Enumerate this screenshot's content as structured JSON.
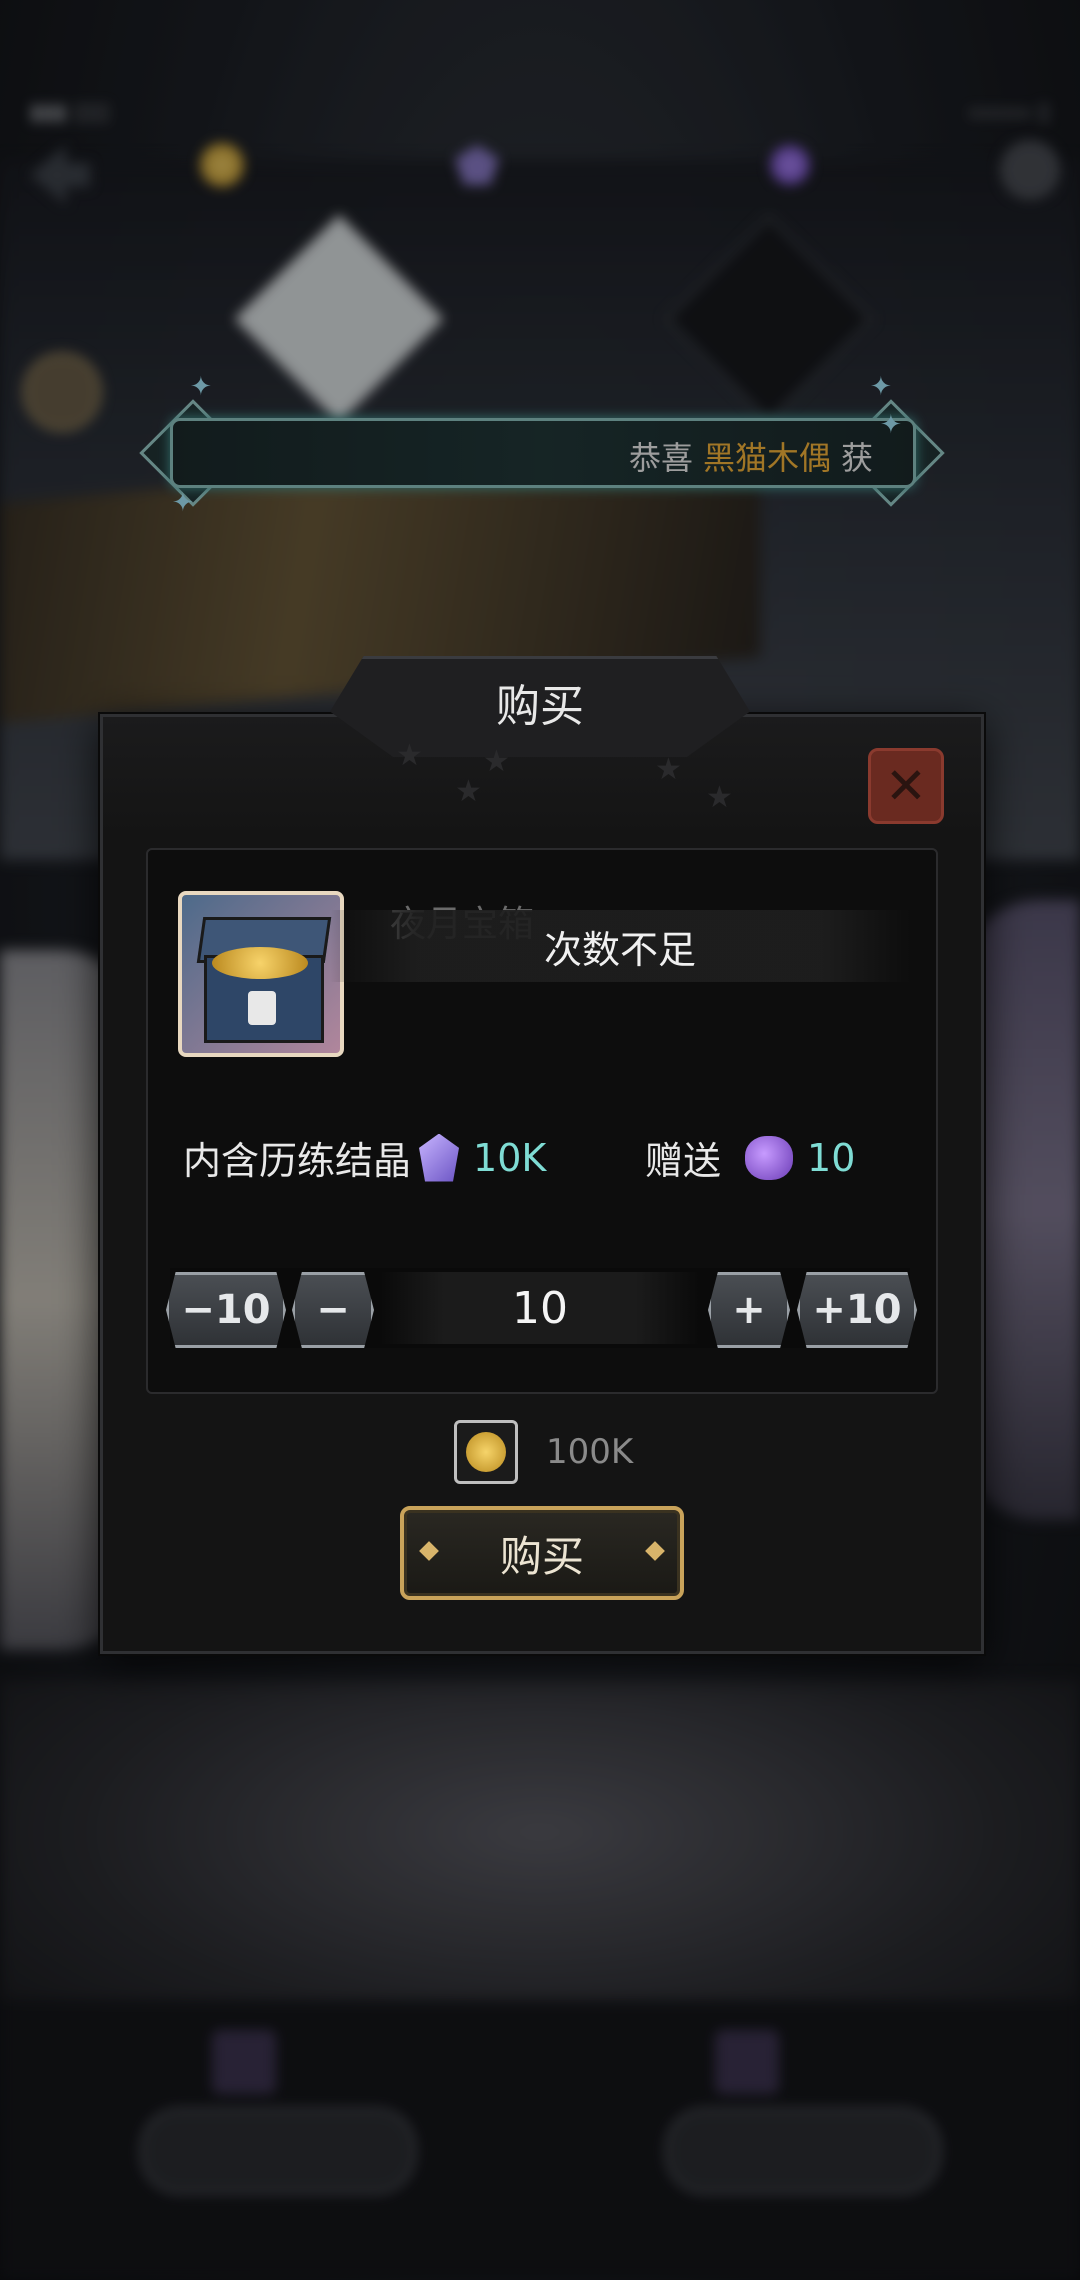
{
  "announcement": {
    "prefix": "恭喜",
    "highlight": "黑猫木偶",
    "suffix": "获"
  },
  "dialog": {
    "title": "购买",
    "item_name": "夜月宝箱",
    "toast": "次数不足",
    "contents_label": "内含历练结晶",
    "contents_value": "10K",
    "gift_label": "赠送",
    "gift_value": "10",
    "quantity": "10",
    "minus10_label": "−10",
    "minus_label": "−",
    "plus_label": "+",
    "plus10_label": "+10",
    "cost_value": "100K",
    "buy_label": "购买"
  },
  "colors": {
    "accent_teal": "#7fdcd4",
    "highlight_gold": "#f7b53b",
    "close_red": "#6a2a20"
  }
}
